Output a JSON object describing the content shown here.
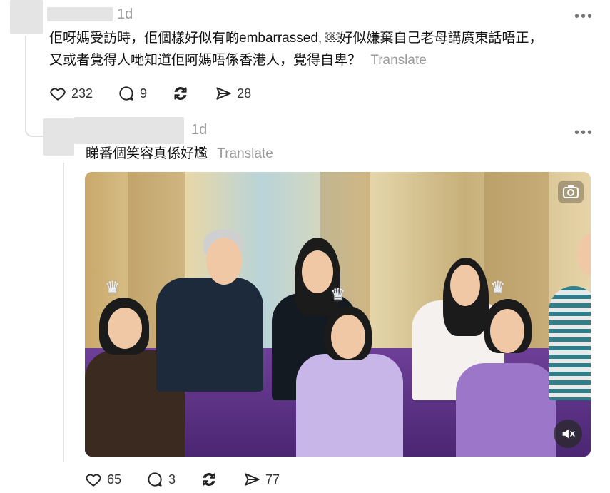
{
  "post1": {
    "timestamp": "1d",
    "text_line1": "佢呀媽受訪時，佢個樣好似有啲embarrassed, ￼好似嫌棄自己老母講廣東話唔正，",
    "text_line2": "又或者覺得人哋知道佢阿媽唔係香港人，覺得自卑？",
    "translate_label": "Translate",
    "likes": "232",
    "replies": "9",
    "shares": "28"
  },
  "post2": {
    "timestamp": "1d",
    "text": "睇番個笑容真係好尷",
    "translate_label": "Translate",
    "likes": "65",
    "replies": "3",
    "shares": "77"
  },
  "icons": {
    "more": "more-horizontal-icon",
    "like": "heart-icon",
    "reply": "comment-icon",
    "repost": "repost-icon",
    "share": "send-icon",
    "camera": "camera-icon",
    "mute": "volume-mute-icon"
  }
}
